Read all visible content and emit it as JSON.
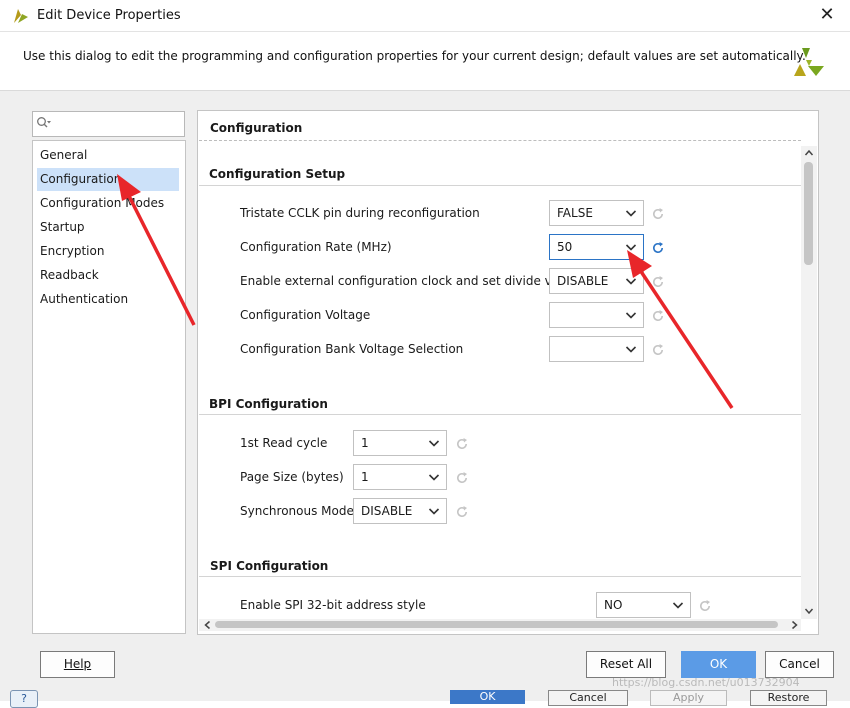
{
  "window": {
    "title": "Edit Device Properties",
    "close_glyph": "✕",
    "icon": "vivado-logo-icon"
  },
  "description": "Use this dialog to edit the programming and configuration properties for your current design; default values are set automatically.",
  "search": {
    "placeholder": "",
    "icon": "search-icon"
  },
  "nav": {
    "items": [
      {
        "label": "General",
        "selected": false
      },
      {
        "label": "Configuration",
        "selected": true
      },
      {
        "label": "Configuration Modes",
        "selected": false
      },
      {
        "label": "Startup",
        "selected": false
      },
      {
        "label": "Encryption",
        "selected": false
      },
      {
        "label": "Readback",
        "selected": false
      },
      {
        "label": "Authentication",
        "selected": false
      }
    ]
  },
  "panel": {
    "title": "Configuration",
    "sections": [
      {
        "title": "Configuration Setup",
        "rows": [
          {
            "label": "Tristate CCLK pin during reconfiguration",
            "value": "FALSE",
            "modified": false
          },
          {
            "label": "Configuration Rate (MHz)",
            "value": "50",
            "modified": true
          },
          {
            "label": "Enable external configuration clock and set divide value",
            "value": "DISABLE",
            "modified": false
          },
          {
            "label": "Configuration Voltage",
            "value": "",
            "modified": false
          },
          {
            "label": "Configuration Bank Voltage Selection",
            "value": "",
            "modified": false
          }
        ]
      },
      {
        "title": "BPI Configuration",
        "rows": [
          {
            "label": "1st Read cycle",
            "value": "1",
            "modified": false
          },
          {
            "label": "Page Size (bytes)",
            "value": "1",
            "modified": false
          },
          {
            "label": "Synchronous Mode",
            "value": "DISABLE",
            "modified": false
          }
        ]
      },
      {
        "title": "SPI Configuration",
        "rows": [
          {
            "label": "Enable SPI 32-bit address style",
            "value": "NO",
            "modified": false
          }
        ]
      }
    ]
  },
  "buttons": {
    "help": "Help",
    "reset_all": "Reset All",
    "ok": "OK",
    "cancel": "Cancel"
  },
  "background_window": {
    "help_glyph": "?",
    "ok": "OK",
    "cancel": "Cancel",
    "apply": "Apply",
    "restore": "Restore"
  },
  "watermark": "https://blog.csdn.net/u013732904",
  "colors": {
    "selection": "#cce1f9",
    "primary_button": "#5b9be6",
    "focus_border": "#2b74c6",
    "annotation_arrow": "#e8262a"
  }
}
